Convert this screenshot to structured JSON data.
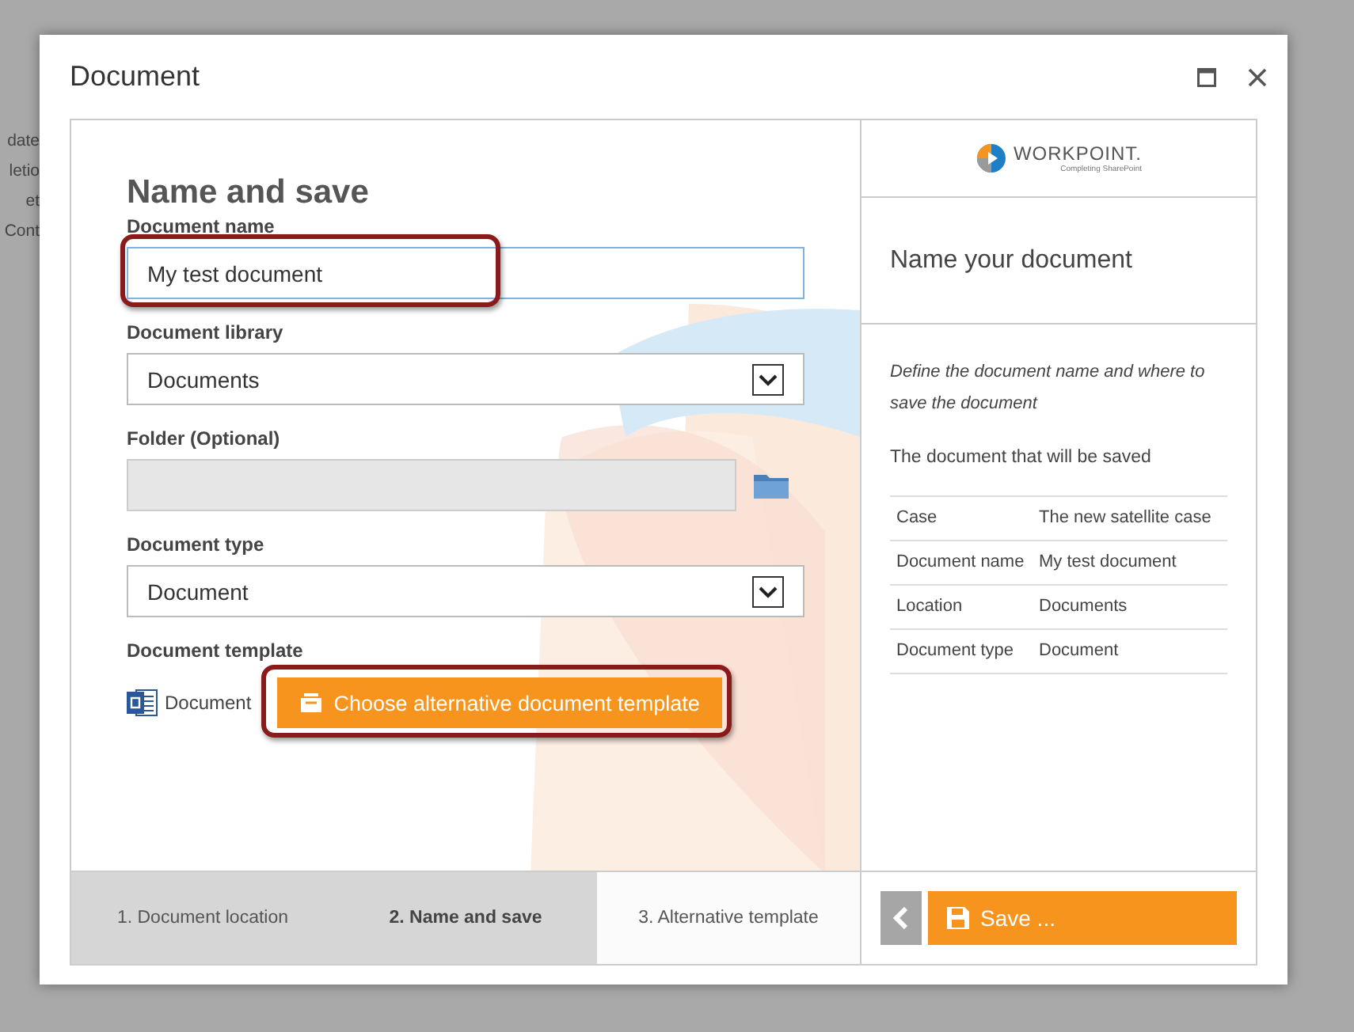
{
  "background_page": {
    "texts": [
      "date",
      "letio",
      "et",
      "Cont"
    ]
  },
  "window": {
    "title": "Document"
  },
  "form": {
    "heading": "Name and save",
    "fields": [
      {
        "kind": "text",
        "label": "Document name",
        "value": "My test document",
        "disabled": false,
        "highlighted": true
      },
      {
        "kind": "dropdown",
        "label": "Document library",
        "value": "Documents",
        "disabled": false,
        "highlighted": false
      },
      {
        "kind": "folder",
        "label": "Folder (Optional)",
        "disabled": true,
        "highlighted": false
      },
      {
        "kind": "dropdown",
        "label": "Document type",
        "value": "Document",
        "disabled": false,
        "highlighted": false
      }
    ],
    "template": {
      "label": "Document template",
      "file": "Document",
      "button": "Choose alternative document template",
      "highlighted": true
    }
  },
  "sidebar": {
    "logo": "WORKPOINT.",
    "tagline": "Completing SharePoint",
    "title": "Name your document",
    "description": "Define the document name and where to save the document",
    "summary_title": "The document that will be saved",
    "summary": [
      {
        "label": "Case",
        "value": "The new satellite case"
      },
      {
        "label": "Document name",
        "value": "My test document"
      },
      {
        "label": "Location",
        "value": "Documents"
      },
      {
        "label": "Document type",
        "value": "Document"
      }
    ]
  },
  "steps": [
    {
      "label": "1. Document location",
      "selected": false,
      "completed": true
    },
    {
      "label": "2. Name and save",
      "selected": true,
      "completed": true
    },
    {
      "label": "3. Alternative template",
      "selected": false,
      "completed": false
    }
  ],
  "actions": {
    "save": "Save ..."
  }
}
